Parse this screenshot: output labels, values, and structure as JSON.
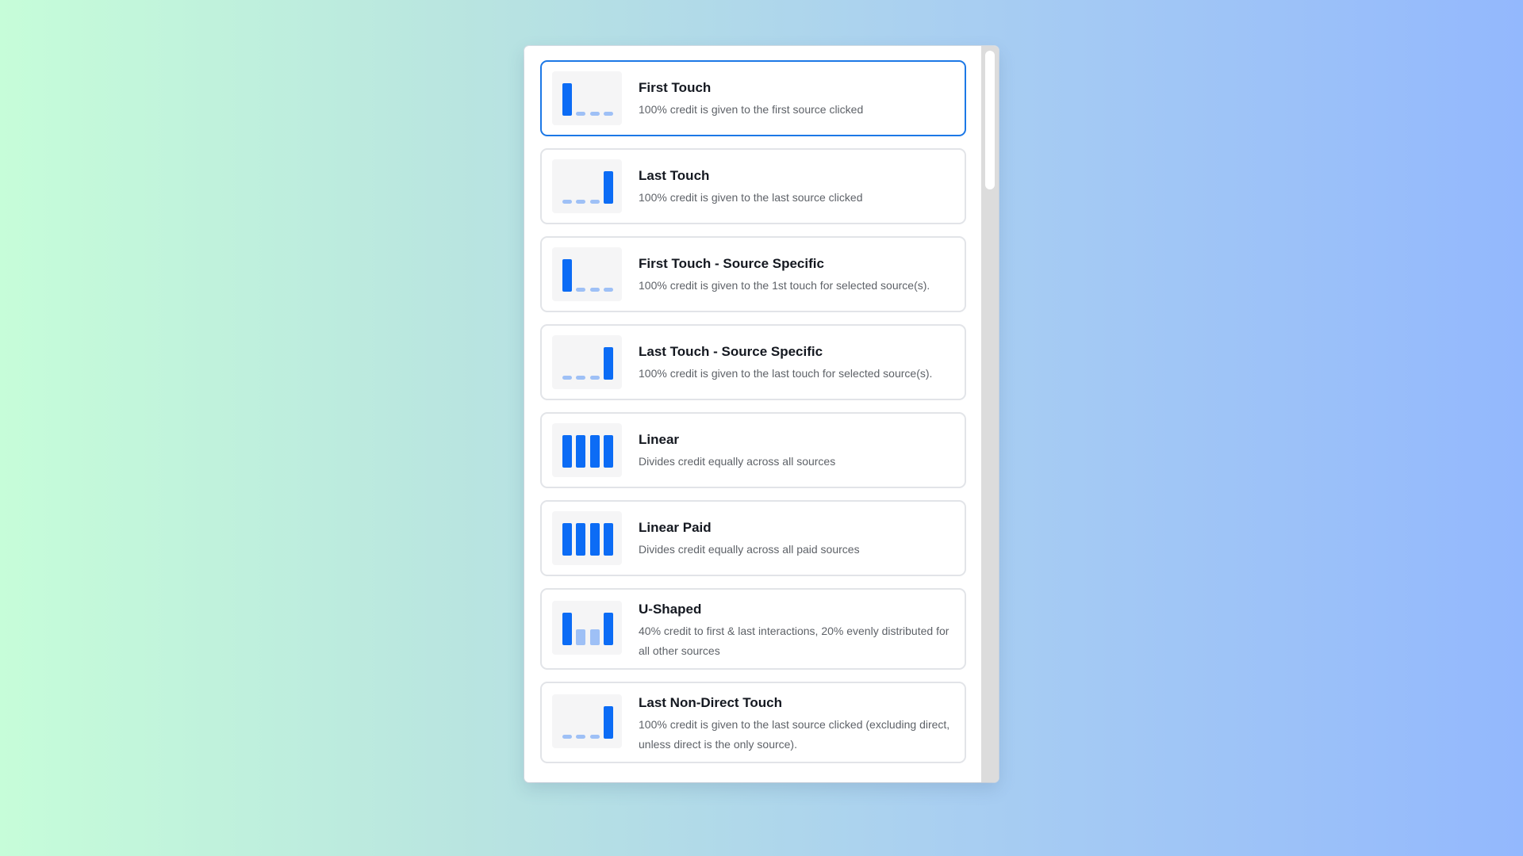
{
  "colors": {
    "accent": "#0c6cf5",
    "accent_light": "#9ec0f6",
    "selected_border": "#1c78e6"
  },
  "models": [
    {
      "title": "First Touch",
      "description": "100% credit is given to the first source clicked",
      "icon": "first-touch-chart-icon"
    },
    {
      "title": "Last Touch",
      "description": "100% credit is given to the last source clicked",
      "icon": "last-touch-chart-icon"
    },
    {
      "title": "First Touch - Source Specific",
      "description": "100% credit is given to the 1st touch for selected source(s).",
      "icon": "first-touch-chart-icon"
    },
    {
      "title": "Last Touch - Source Specific",
      "description": "100% credit is given to the last touch for selected source(s).",
      "icon": "last-touch-chart-icon"
    },
    {
      "title": "Linear",
      "description": "Divides credit equally across all sources",
      "icon": "linear-chart-icon"
    },
    {
      "title": "Linear Paid",
      "description": "Divides credit equally across all paid sources",
      "icon": "linear-chart-icon"
    },
    {
      "title": "U-Shaped",
      "description": "40% credit to first & last interactions, 20% evenly distributed for all other sources",
      "icon": "u-shaped-chart-icon"
    },
    {
      "title": "Last Non-Direct Touch",
      "description": "100% credit is given to the last source clicked (excluding direct, unless direct is the only source).",
      "icon": "last-touch-chart-icon"
    }
  ]
}
